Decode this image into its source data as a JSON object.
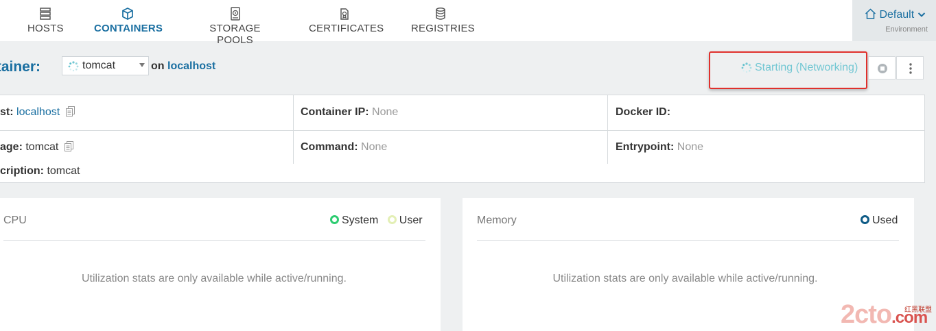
{
  "nav": {
    "items": [
      {
        "label": "HOSTS",
        "icon": "hosts-icon"
      },
      {
        "label": "CONTAINERS",
        "icon": "cube-icon",
        "active": true
      },
      {
        "label": "STORAGE POOLS",
        "icon": "storage-icon"
      },
      {
        "label": "CERTIFICATES",
        "icon": "certificate-icon"
      },
      {
        "label": "REGISTRIES",
        "icon": "database-icon"
      }
    ],
    "environment": {
      "name": "Default",
      "sub": "Environment"
    }
  },
  "header": {
    "title": "ntainer:",
    "container_select": "tomcat",
    "on_text": "on",
    "host_link": "localhost",
    "status": "Starting (Networking)"
  },
  "info": {
    "host_label": "st:",
    "host_value": "localhost",
    "image_label": "age:",
    "image_value": "tomcat",
    "description_label": "cription:",
    "description_value": "tomcat",
    "ip_label": "Container IP:",
    "ip_value": "None",
    "command_label": "Command:",
    "command_value": "None",
    "docker_label": "Docker ID:",
    "entrypoint_label": "Entrypoint:",
    "entrypoint_value": "None"
  },
  "cpu": {
    "title": "CPU",
    "legend": [
      "System",
      "User"
    ],
    "message": "Utilization stats are only available while active/running."
  },
  "memory": {
    "title": "Memory",
    "legend": [
      "Used"
    ],
    "message": "Utilization stats are only available while active/running."
  },
  "watermark": {
    "main": "2cto",
    "suffix": ".com",
    "small": "红黑联盟"
  },
  "colors": {
    "accent": "#1a6fa1",
    "status": "#72c7d3",
    "system": "#2ecc71",
    "user": "#e3efb5",
    "used": "#0e5b86",
    "highlight": "#e0302c"
  }
}
